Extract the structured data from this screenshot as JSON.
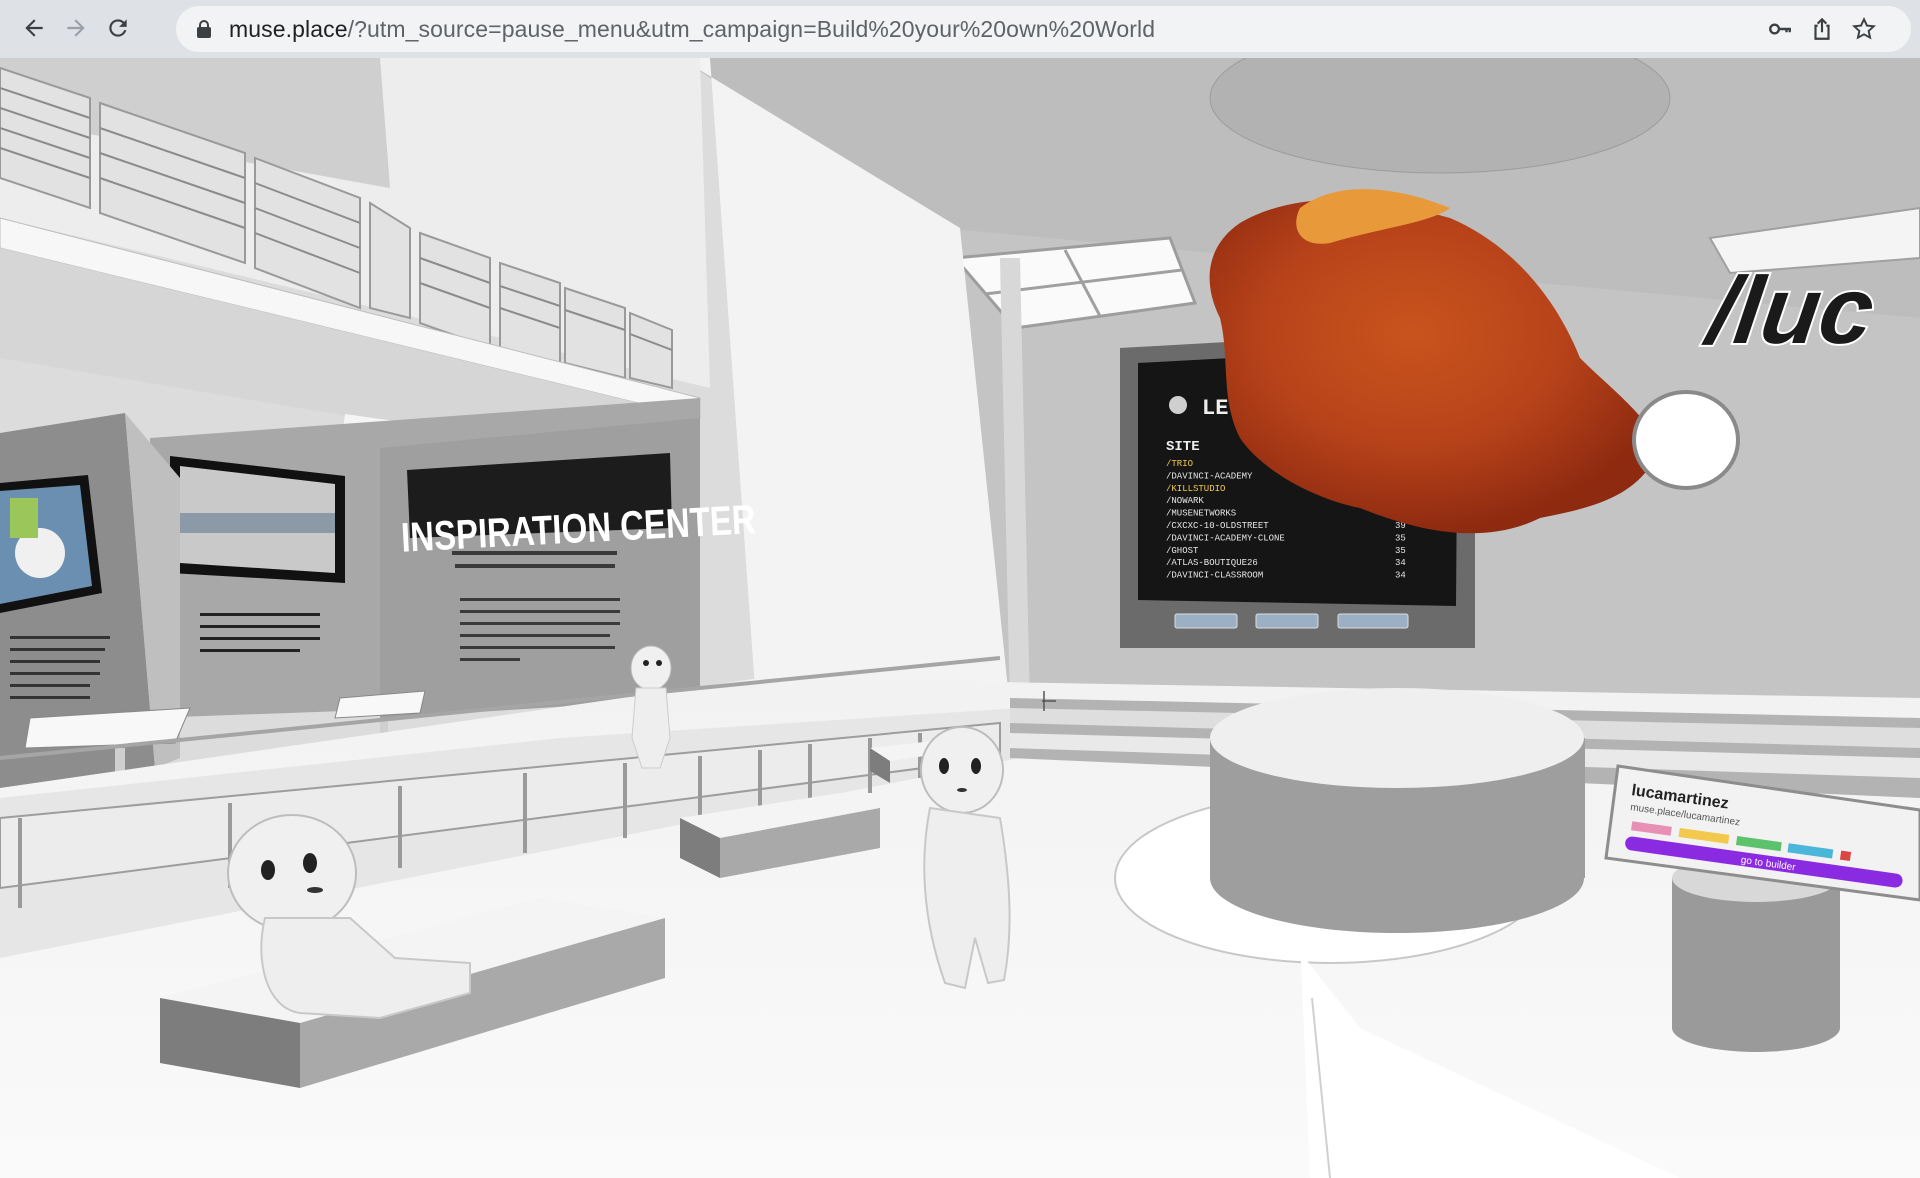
{
  "browser": {
    "url_host": "muse.place",
    "url_rest": "/?utm_source=pause_menu&utm_campaign=Build%20your%20own%20World"
  },
  "scene": {
    "inspiration_sign": "INSPIRATION CENTER",
    "world_label": "/luc",
    "leaderboard": {
      "title": "LE",
      "column_header": "SITE",
      "rows": [
        {
          "site": "/TRIO",
          "score": ""
        },
        {
          "site": "/DAVINCI-ACADEMY",
          "score": ""
        },
        {
          "site": "/KILLSTUDIO",
          "score": ""
        },
        {
          "site": "/NOWARK",
          "score": ""
        },
        {
          "site": "/MUSENETWORKS",
          "score": ""
        },
        {
          "site": "/CXCXC-10-OLDSTREET",
          "score": "39"
        },
        {
          "site": "/DAVINCI-ACADEMY-CLONE",
          "score": "35"
        },
        {
          "site": "/GHOST",
          "score": "35"
        },
        {
          "site": "/ATLAS-BOUTIQUE26",
          "score": "34"
        },
        {
          "site": "/DAVINCI-CLASSROOM",
          "score": "34"
        }
      ]
    },
    "profile_card": {
      "name": "lucamartinez",
      "url": "muse.place/lucamartinez",
      "button": "go to builder"
    },
    "wall_text": {
      "left": "Donny adds new worlds daily. Follow his twitter handle to be first to discover a new world",
      "mid": "Donny Inland has compiled 100s of 3D websites built by users so you can browse our inspiration center.",
      "mid2": "Donny was so inspired by all the muse worlds he saw that he wanted to share all the creativity in one central hub. Navigate the worlds within this site to discover more muse sites built by creators just like you."
    },
    "colors": {
      "accent_yellow": "#f2c94c",
      "orb": "#d4561a",
      "purple": "#8a2be2"
    }
  }
}
